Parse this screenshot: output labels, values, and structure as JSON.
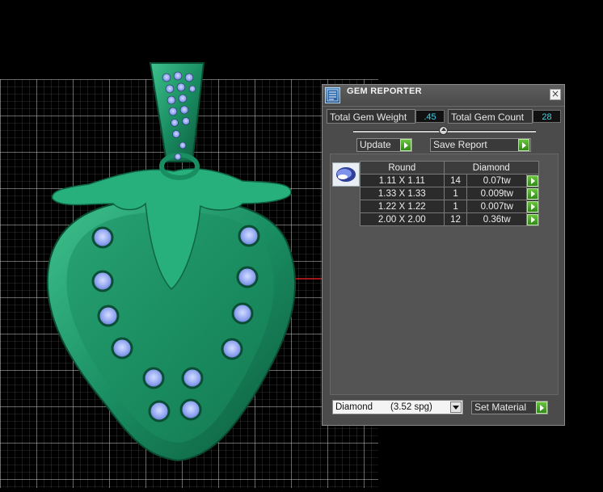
{
  "panel": {
    "title": "GEM REPORTER",
    "close_label": "×",
    "total_weight_label": "Total Gem Weight",
    "total_weight_value": ".45",
    "total_count_label": "Total Gem Count",
    "total_count_value": "28",
    "update_label": "Update",
    "save_report_label": "Save Report",
    "set_material_label": "Set Material",
    "material": {
      "name": "Diamond",
      "spg": "(3.52 spg)"
    },
    "table": {
      "headers": [
        "Round",
        "Diamond"
      ],
      "rows": [
        {
          "size": "1.11 X 1.11",
          "count": "14",
          "weight": "0.07tw"
        },
        {
          "size": "1.33 X 1.33",
          "count": "1",
          "weight": "0.009tw"
        },
        {
          "size": "1.22 X 1.22",
          "count": "1",
          "weight": "0.007tw"
        },
        {
          "size": "2.00 X 2.00",
          "count": "12",
          "weight": "0.36tw"
        }
      ]
    }
  },
  "colors": {
    "metal": "#1f9a6c",
    "gem": "#8fa4f0",
    "grid": "#cfcfcf",
    "accent_green": "#4caf2a",
    "value_cyan": "#3fd3e8"
  },
  "icons": [
    "gem-reporter-icon",
    "close-icon",
    "play-arrow-icon",
    "dropdown-arrow-icon",
    "round-gem-icon"
  ]
}
